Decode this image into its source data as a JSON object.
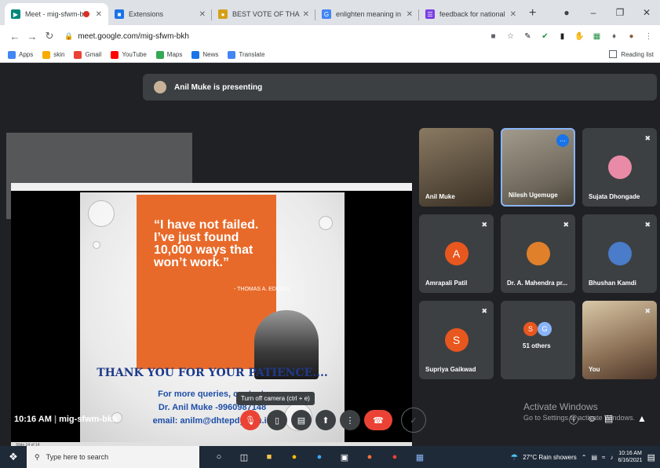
{
  "browser": {
    "tabs": [
      {
        "title": "Meet - mig-sfwm-bkh",
        "color": "#00897b"
      },
      {
        "title": "Extensions",
        "color": "#1a73e8"
      },
      {
        "title": "BEST VOTE OF THANKS SPEE",
        "color": "#d4a017"
      },
      {
        "title": "enlighten meaning in englis",
        "color": "#4285f4"
      },
      {
        "title": "feedback for national level le",
        "color": "#7b3fe4"
      }
    ],
    "url": "meet.google.com/mig-sfwm-bkh",
    "bookmarks": [
      "Apps",
      "skin",
      "Gmail",
      "YouTube",
      "Maps",
      "News",
      "Translate"
    ],
    "reading_list": "Reading list"
  },
  "meet": {
    "presenting_banner": "Anil Muke is presenting",
    "slide": {
      "quote": "“I have not failed. I’ve just found 10,000 ways that won’t work.”",
      "attribution": "- THOMAS A. EDISON",
      "thanks": "THANK YOU FOR YOUR PATIENCE....",
      "queries_line1": "For more queries, contact:",
      "queries_line2": "Dr. Anil Muke -9960987148",
      "queries_line3": "email: anilm@dhtepdy.edu.in",
      "footer": "Slide 14 of 14"
    },
    "participants": [
      {
        "name": "Anil Muke"
      },
      {
        "name": "Nilesh Ugemuge"
      },
      {
        "name": "Sujata Dhongade"
      },
      {
        "name": "Amrapali Patil",
        "initial": "A",
        "color": "#e8571e"
      },
      {
        "name": "Dr. A. Mahendra pr..."
      },
      {
        "name": "Bhushan Kamdi"
      },
      {
        "name": "Supriya Gaikwad",
        "initial": "S",
        "color": "#e8571e"
      },
      {
        "name": "51 others",
        "initial_a": "S",
        "initial_b": "G"
      },
      {
        "name": "You"
      }
    ],
    "time": "10:16 AM",
    "meeting_code": "mig-sfwm-bkh",
    "tooltip": "Turn off camera (ctrl + e)",
    "activate_title": "Activate Windows",
    "activate_sub": "Go to Settings to activate Windows."
  },
  "taskbar": {
    "search_placeholder": "Type here to search",
    "weather": "27°C Rain showers",
    "clock_time": "10:16 AM",
    "clock_date": "6/16/2021"
  }
}
